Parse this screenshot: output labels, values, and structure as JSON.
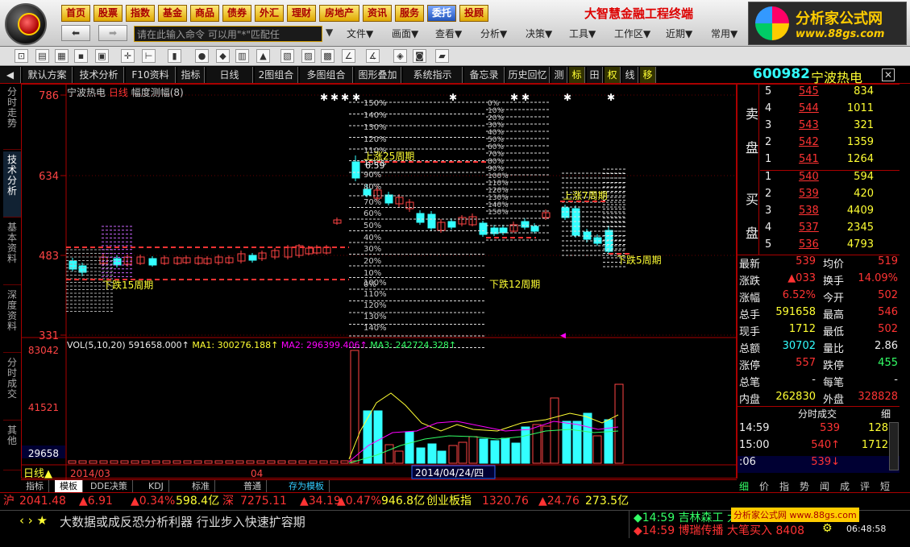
{
  "top_nav": [
    "首页",
    "股票",
    "指数",
    "基金",
    "商品",
    "债券",
    "外汇",
    "理财",
    "房地产",
    "资讯",
    "服务",
    "委托",
    "投顾"
  ],
  "top_nav_active": "委托",
  "brand_title": "大智慧金融工程终端",
  "brand_logo": {
    "name": "分析家公式网",
    "url": "www.88gs.com"
  },
  "cmd_placeholder": "请在此输入命令   可以用\"*\"匹配任",
  "menu": [
    "文件▼",
    "画面▼",
    "查看▼",
    "分析▼",
    "决策▼",
    "工具▼",
    "工作区▼",
    "近期▼",
    "常用▼"
  ],
  "tabs": [
    "默认方案",
    "技术分析",
    "F10资料",
    "指标",
    "日线",
    "2图组合",
    "多图组合",
    "图形叠加",
    "系统指示",
    "备忘录",
    "历史回忆",
    "测",
    "标",
    "田",
    "权",
    "线",
    "移"
  ],
  "side_tabs": [
    "分时走势",
    "技术分析",
    "基本资料",
    "深度资料",
    "分时成交",
    "其他"
  ],
  "side_tab_active": "技术分析",
  "chart_title": {
    "name": "宁波热电",
    "period": "日线",
    "extra": "幅度测幅(8)"
  },
  "price_axis": [
    "786",
    "634",
    "483",
    "331"
  ],
  "vol_axis": [
    "83042",
    "41521",
    "29658"
  ],
  "vol_header": {
    "label": "VOL(5,10,20)",
    "vol": "591658.000↑",
    "ma1": "MA1: 300276.188↑",
    "ma2": "MA2: 296399.406↑",
    "ma3": "MA3: 242724.328↑"
  },
  "annotations": [
    "上涨25周期",
    "下跌15周期",
    "下跌12周期",
    "上涨7周期",
    "下跌5周期",
    "6.59"
  ],
  "pct_labels": [
    "150%",
    "140%",
    "130%",
    "120%",
    "110%",
    "100%",
    "90%",
    "80%",
    "70%",
    "60%",
    "50%",
    "40%",
    "30%",
    "20%",
    "10%",
    "0%"
  ],
  "date_axis": {
    "period": "日线",
    "year": "2014/03",
    "mark": "04",
    "cursor": "2014/04/24/四"
  },
  "stock": {
    "code": "600982",
    "name": "宁波热电"
  },
  "sell": [
    {
      "n": "5",
      "p": "545",
      "v": "834"
    },
    {
      "n": "4",
      "p": "544",
      "v": "1011"
    },
    {
      "n": "3",
      "p": "543",
      "v": "321"
    },
    {
      "n": "2",
      "p": "542",
      "v": "1359"
    },
    {
      "n": "1",
      "p": "541",
      "v": "1264"
    }
  ],
  "buy": [
    {
      "n": "1",
      "p": "540",
      "v": "594"
    },
    {
      "n": "2",
      "p": "539",
      "v": "420"
    },
    {
      "n": "3",
      "p": "538",
      "v": "4409"
    },
    {
      "n": "4",
      "p": "537",
      "v": "2345"
    },
    {
      "n": "5",
      "p": "536",
      "v": "4793"
    }
  ],
  "sell_label": [
    "卖",
    "盘"
  ],
  "buy_label": [
    "买",
    "盘"
  ],
  "stats": [
    [
      "最新",
      "539",
      "均价",
      "519"
    ],
    [
      "涨跌",
      "▲033",
      "换手",
      "14.09%"
    ],
    [
      "涨幅",
      "6.52%",
      "今开",
      "502"
    ],
    [
      "总手",
      "591658",
      "最高",
      "546"
    ],
    [
      "现手",
      "1712",
      "最低",
      "502"
    ],
    [
      "总额",
      "30702",
      "量比",
      "2.86"
    ],
    [
      "涨停",
      "557",
      "跌停",
      "455"
    ],
    [
      "总笔",
      "-",
      "每笔",
      "-"
    ],
    [
      "内盘",
      "262830",
      "外盘",
      "328828"
    ]
  ],
  "trades_title": "分时成交",
  "trades_sub": "细",
  "trades": [
    [
      "14:59",
      "539",
      "128"
    ],
    [
      "15:00",
      "540↑",
      "1712"
    ],
    [
      ":06",
      "539↓",
      ""
    ]
  ],
  "quote_tabs": [
    "细",
    "价",
    "指",
    "势",
    "闻",
    "成",
    "评",
    "短"
  ],
  "bottom_tabs": [
    "指标",
    "模板",
    "DDE决策",
    "KDJ",
    "标准",
    "普通",
    "存为模板"
  ],
  "ticker": {
    "sh": "沪",
    "sh_val": "2041.48",
    "sh_chg": "▲6.91",
    "sh_pct": "▲0.34%",
    "sh_amt": "598.4亿",
    "sz": "深",
    "sz_val": "7275.11",
    "sz_chg": "▲34.19",
    "sz_pct": "▲0.47%",
    "sz_amt": "946.8亿",
    "cy": "创业板指",
    "cy_val": "1320.76",
    "cy_chg": "▲24.76",
    "cy_amt": "273.5亿"
  },
  "news": "大数据或成反恐分析利器 行业步入快速扩容期",
  "alerts": [
    "◆14:59 吉林森工 大笔买入",
    "◆14:59 博瑞传播 大笔买入 8408"
  ],
  "watermark": "分析家公式网 www.88gs.com",
  "clock": "06:48:58",
  "colors": {
    "up": "#ff3333",
    "down": "#33ffff",
    "accent": "#ffcc00"
  }
}
